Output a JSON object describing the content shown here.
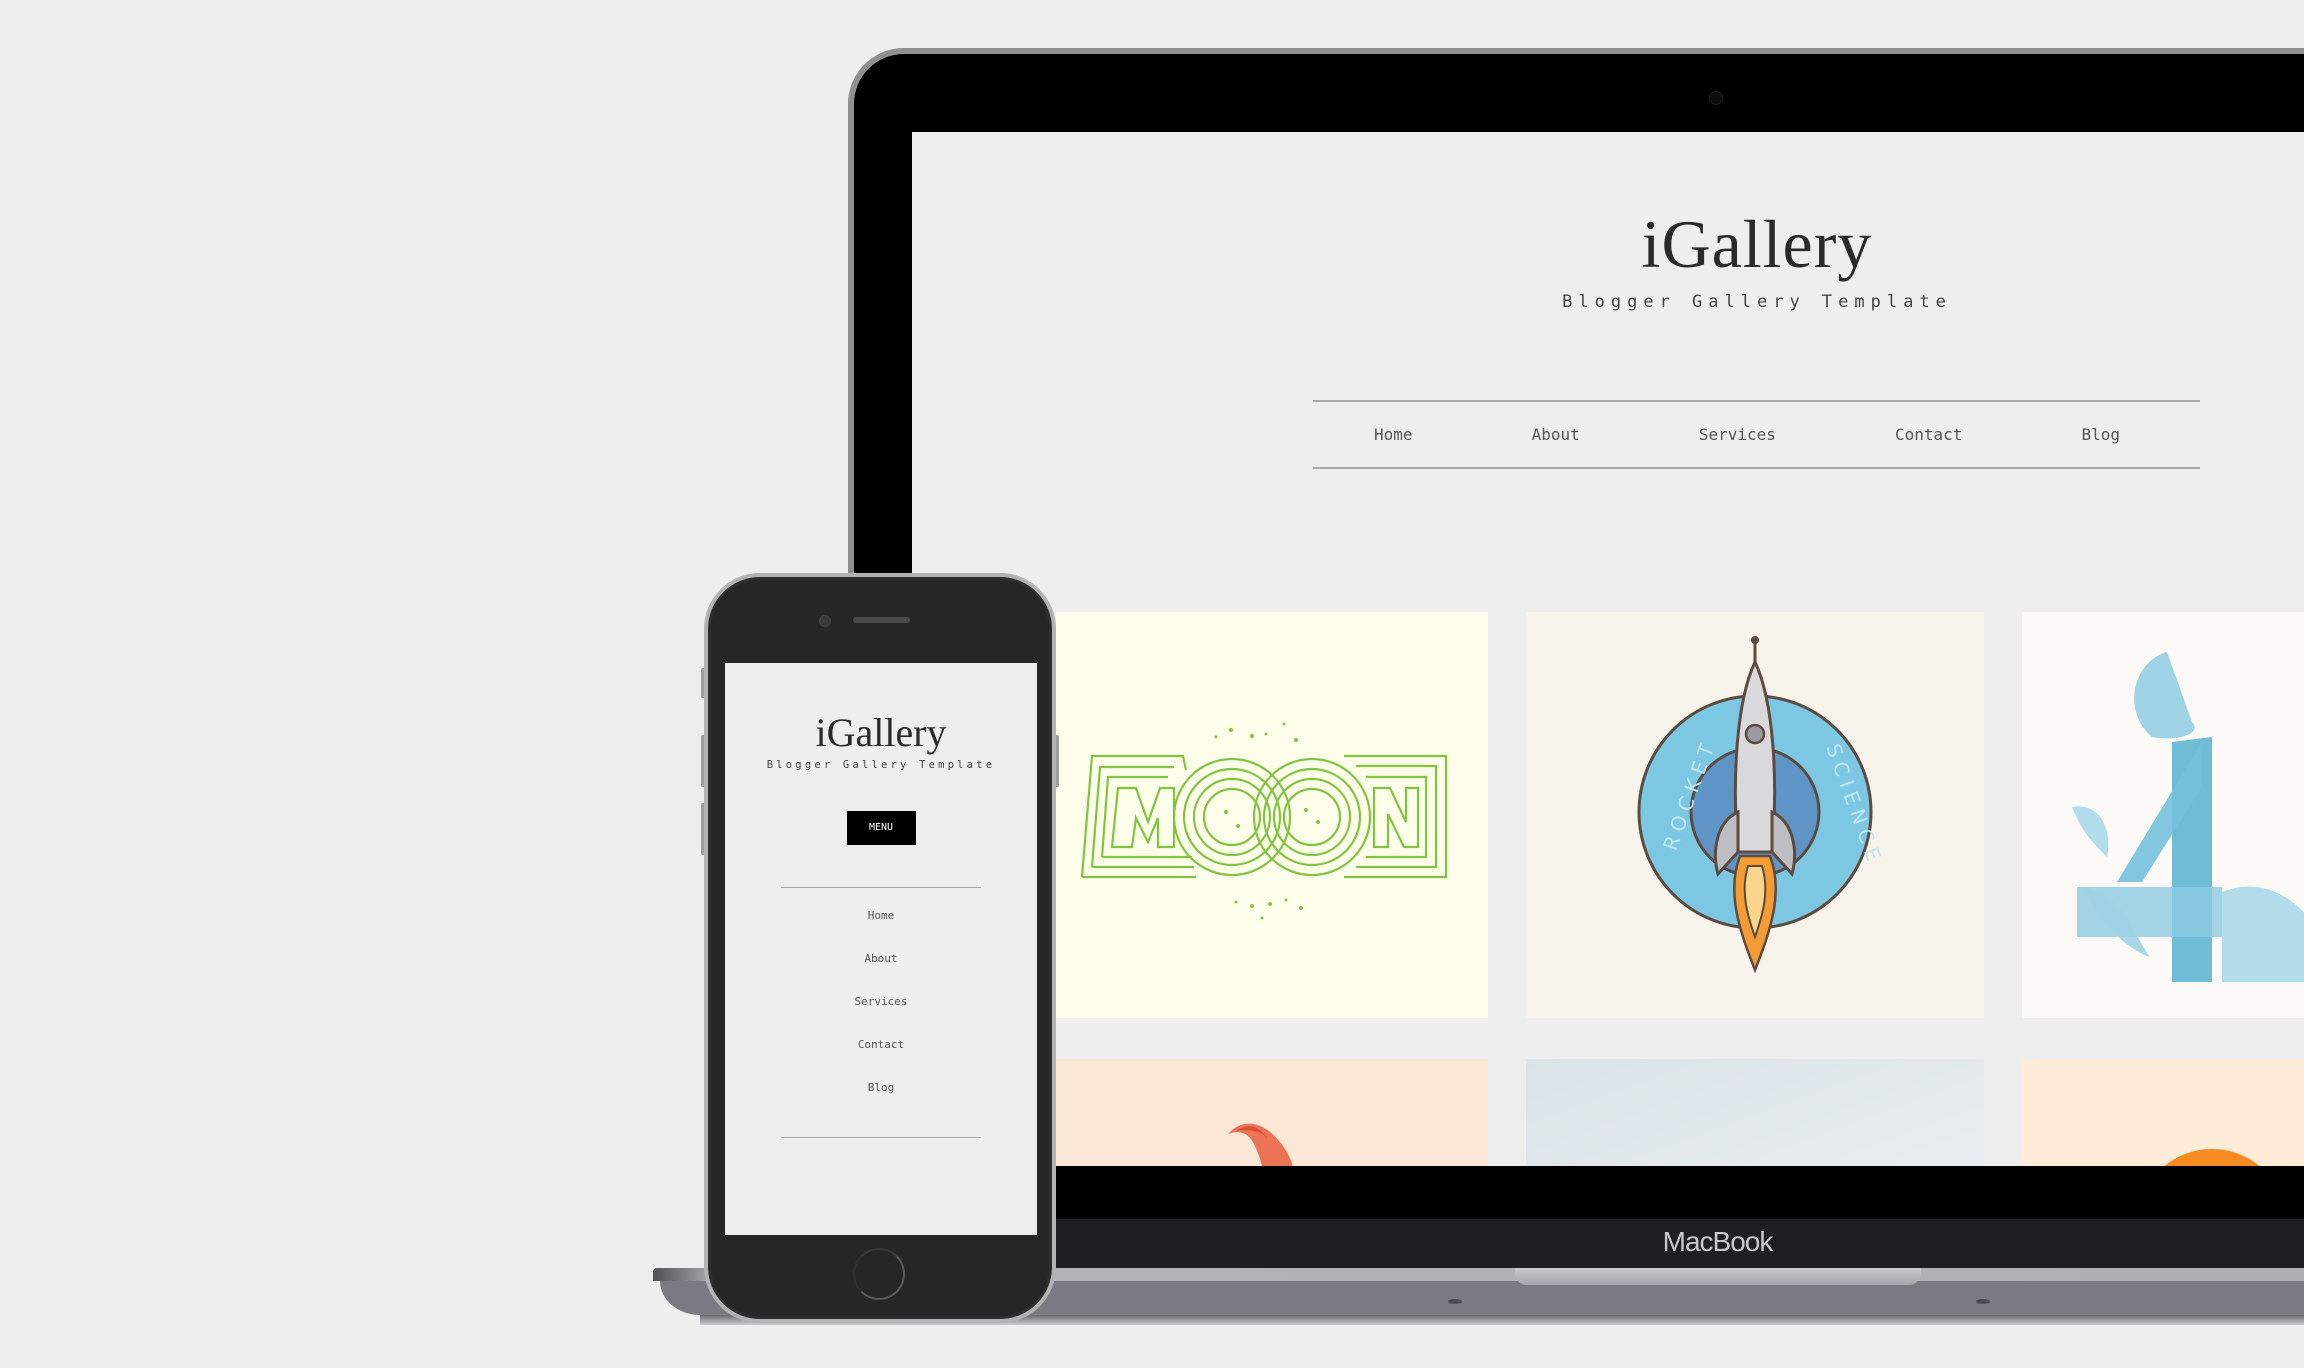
{
  "device_labels": {
    "laptop_brand": "MacBook"
  },
  "desktop_site": {
    "title": "iGallery",
    "subtitle": "Blogger Gallery Template",
    "nav": [
      {
        "label": "Home"
      },
      {
        "label": "About"
      },
      {
        "label": "Services"
      },
      {
        "label": "Contact"
      },
      {
        "label": "Blog"
      }
    ],
    "gallery": [
      {
        "name": "moon",
        "description": "MOON line-art lettering",
        "bg": "#fcfee9",
        "accent": "#82c341"
      },
      {
        "name": "rocket-science",
        "description": "Rocket Science badge",
        "bg": "#f7f2ea",
        "accent": "#7cc7e2",
        "badge_text_left": "ROCKET",
        "badge_text_right": "SCIENCE"
      },
      {
        "name": "blue-four",
        "description": "Geometric blue number four",
        "bg": "#fcfaf7",
        "accent": "#6ec1d9"
      },
      {
        "name": "orange-flame",
        "description": "Orange shape (partially visible)",
        "bg": "#fbe7d6",
        "accent": "#ec7355"
      },
      {
        "name": "blue-gray",
        "description": "Light blue-gray image (partially visible)",
        "bg": "#dfe6ea",
        "accent": "#e8eef1"
      },
      {
        "name": "orange-sun",
        "description": "Orange circle (partially visible)",
        "bg": "#fdecd8",
        "accent": "#f68b1f"
      }
    ]
  },
  "mobile_site": {
    "title": "iGallery",
    "subtitle": "Blogger Gallery Template",
    "menu_button": "MENU",
    "nav": [
      {
        "label": "Home"
      },
      {
        "label": "About"
      },
      {
        "label": "Services"
      },
      {
        "label": "Contact"
      },
      {
        "label": "Blog"
      }
    ]
  },
  "colors": {
    "page_bg": "#eeeeee",
    "nav_border": "#a9a9a9",
    "text": "#555555",
    "title": "#2a2a2a"
  }
}
